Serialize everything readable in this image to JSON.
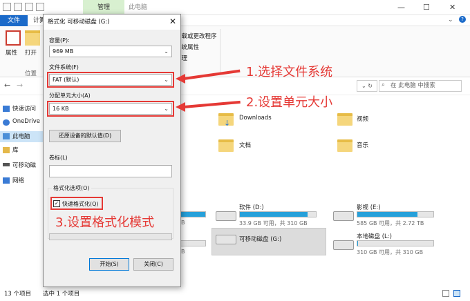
{
  "titlebar": {
    "manage_tab": "管理",
    "thispc_tab": "此电脑",
    "minimize": "—",
    "maximize": "☐",
    "close": "✕"
  },
  "ribbon_tabs": {
    "file": "文件",
    "computer": "计算"
  },
  "ribbon": {
    "properties": "属性",
    "open": "打开",
    "location_group": "位置",
    "item1": "卸载或更改程序",
    "item2": "系统属性",
    "item3": "管理",
    "item4": "目"
  },
  "address": {
    "dropdown": "⌄ ↻",
    "search_placeholder": "在 此电脑 中搜索"
  },
  "nav": [
    {
      "label": "快速访问",
      "color": "#3a7bd5"
    },
    {
      "label": "OneDrive",
      "color": "#3a7bd5"
    },
    {
      "label": "此电脑",
      "color": "#4a8fd8"
    },
    {
      "label": "库",
      "color": "#e4b84a"
    },
    {
      "label": "可移动磁",
      "color": "#555555"
    },
    {
      "label": "网络",
      "color": "#3a7bd5"
    }
  ],
  "folders": [
    {
      "label": "Downloads"
    },
    {
      "label": "视频"
    },
    {
      "label": "文档"
    },
    {
      "label": "音乐"
    }
  ],
  "drives": [
    {
      "name": "软件 (D:)",
      "free": "33.9 GB 可用，共 310 GB",
      "fill": 0.89
    },
    {
      "name": "影视 (E:)",
      "free": "585 GB 可用，共 2.72 TB",
      "fill": 0.79
    },
    {
      "name": "可移动磁盘 (G:)",
      "free": "",
      "fill": null
    },
    {
      "name": "本地磁盘 (L:)",
      "free": "310 GB 可用，共 310 GB",
      "fill": 0.01
    }
  ],
  "left_drives": [
    {
      "free": "B"
    },
    {
      "free": "B"
    }
  ],
  "status": {
    "items": "13 个项目",
    "selected": "选中 1 个项目"
  },
  "dialog": {
    "title": "格式化 可移动磁盘 (G:)",
    "capacity_label": "容量(P):",
    "capacity_value": "969 MB",
    "fs_label": "文件系统(F)",
    "fs_value": "FAT (默认)",
    "alloc_label": "分配单元大小(A)",
    "alloc_value": "16 KB",
    "restore_button": "还原设备的默认值(D)",
    "volume_label": "卷标(L)",
    "volume_value": "",
    "options_label": "格式化选项(O)",
    "quick_format": "快速格式化(Q)",
    "quick_checked": "✓",
    "start_button": "开始(S)",
    "close_button": "关闭(C)",
    "close_x": "✕",
    "dropdown_arrow": "⌄"
  },
  "annotations": {
    "step1": "1.选择文件系统",
    "step2": "2.设置单元大小",
    "step3": "3.设置格式化模式"
  }
}
